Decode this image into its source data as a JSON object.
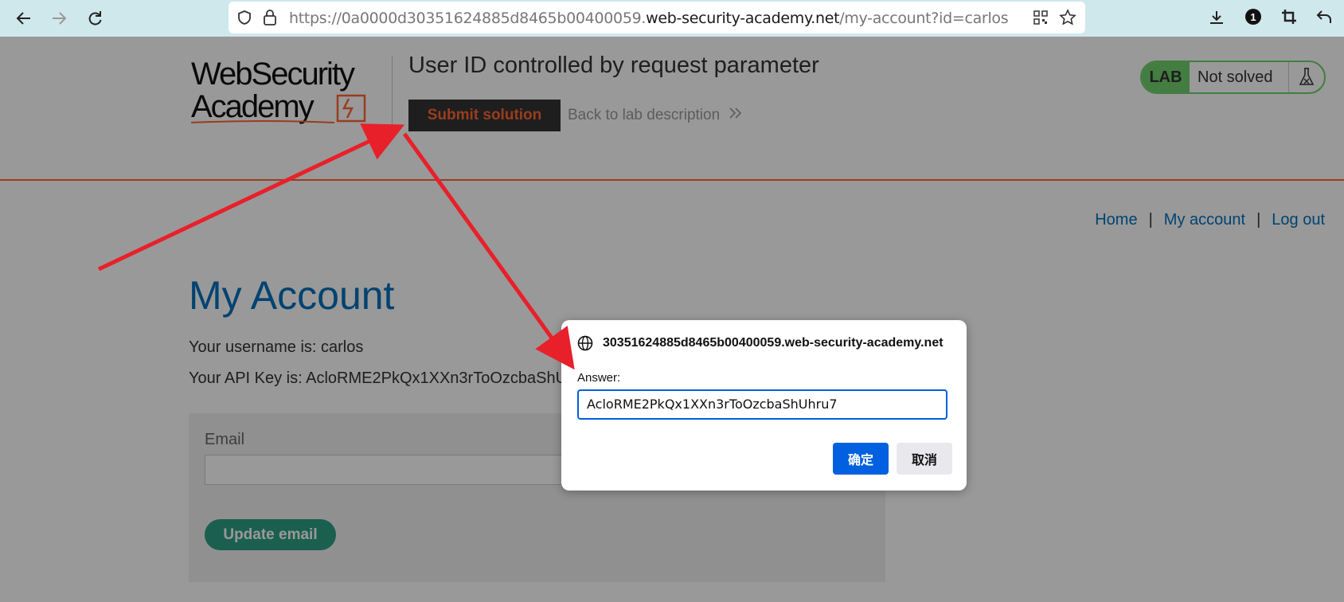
{
  "browser": {
    "url_prefix": "https://0a0000d30351624885d8465b00400059.",
    "url_domain": "web-security-academy.net",
    "url_path": "/my-account?id=carlos"
  },
  "header": {
    "logo_line1": "WebSecurity",
    "logo_line2": "Academy",
    "lab_title": "User ID controlled by request parameter",
    "submit_label": "Submit solution",
    "back_label": "Back to lab description",
    "lab_badge": "LAB",
    "lab_status": "Not solved"
  },
  "nav": {
    "home": "Home",
    "sep": "|",
    "my_account": "My account",
    "log_out": "Log out"
  },
  "main": {
    "title": "My Account",
    "username_text": "Your username is: carlos",
    "api_key_text": "Your API Key is: AcloRME2PkQx1XXn3rToOzcbaShU",
    "email_label": "Email",
    "update_label": "Update email"
  },
  "dialog": {
    "origin_faded": "",
    "origin": "30351624885d8465b00400059.web-security-academy.net",
    "answer_label": "Answer:",
    "answer_value": "AcloRME2PkQx1XXn3rToOzcbaShUhru7",
    "ok_label": "确定",
    "cancel_label": "取消"
  },
  "colors": {
    "chrome_bg": "#cfe8ec",
    "accent_orange": "#ff6633",
    "link_blue": "#0071bc",
    "lab_green": "#70d16d",
    "dialog_blue": "#0060df",
    "arrow_red": "#e8202a"
  }
}
